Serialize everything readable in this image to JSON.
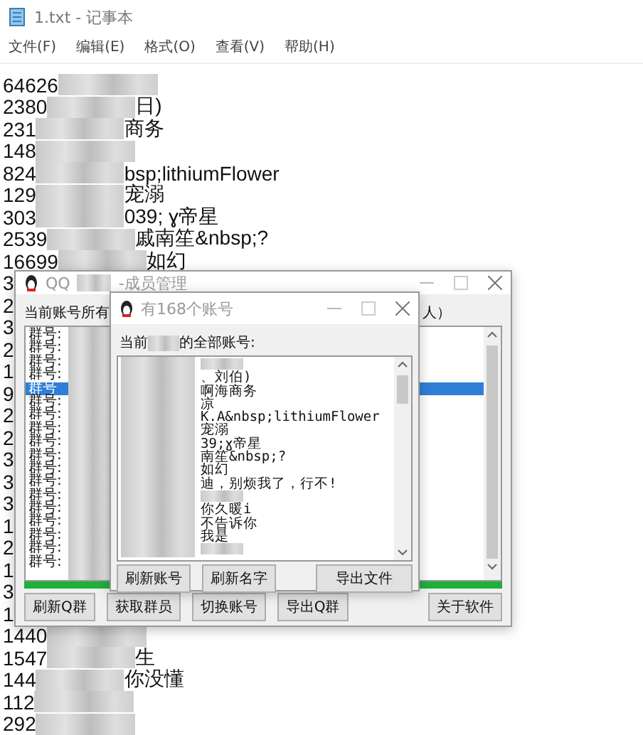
{
  "notepad": {
    "title": "1.txt - 记事本",
    "menu": [
      "文件(F)",
      "编辑(E)",
      "格式(O)",
      "查看(V)",
      "帮助(H)"
    ],
    "lines": [
      {
        "prefix": "64626",
        "redacted": true
      },
      {
        "prefix": "2380",
        "redacted": true,
        "suffix": "日)"
      },
      {
        "prefix": "231",
        "redacted": true,
        "suffix": "商务"
      },
      {
        "prefix": "148",
        "redacted": true
      },
      {
        "prefix": "824",
        "redacted": true,
        "suffix": "bsp;lithiumFlower"
      },
      {
        "prefix": "129",
        "redacted": true,
        "suffix": "宠溺"
      },
      {
        "prefix": "303",
        "redacted": true,
        "suffix": "039; ɣ帝星"
      },
      {
        "prefix": "2539",
        "redacted": true,
        "suffix": "戚南笙&nbsp;?"
      },
      {
        "prefix": "16699",
        "redacted": true,
        "suffix": "如幻"
      },
      {
        "prefix": "3"
      },
      {
        "prefix": "2"
      },
      {
        "prefix": "3"
      },
      {
        "prefix": "2"
      },
      {
        "prefix": "1"
      },
      {
        "prefix": "9"
      },
      {
        "prefix": "2"
      },
      {
        "prefix": "2"
      },
      {
        "prefix": "3"
      },
      {
        "prefix": "3"
      },
      {
        "prefix": "3"
      },
      {
        "prefix": "1"
      },
      {
        "prefix": "2"
      },
      {
        "prefix": "1"
      },
      {
        "prefix": "3"
      },
      {
        "prefix": "1"
      },
      {
        "prefix": "1440",
        "redacted": true
      },
      {
        "prefix": "1547",
        "redacted": true,
        "suffix": "生"
      },
      {
        "prefix": "144",
        "redacted": true,
        "suffix": "你没懂"
      },
      {
        "prefix": "112",
        "redacted": true
      },
      {
        "prefix": "292",
        "redacted": true
      }
    ]
  },
  "qq_window": {
    "title_prefix": "QQ",
    "title_suffix": "-成员管理",
    "header_left": "当前账号所有",
    "header_right": "人）",
    "groups": [
      {
        "label": "群号:",
        "selected": false
      },
      {
        "label": "群号:",
        "selected": false
      },
      {
        "label": "群号:",
        "selected": false
      },
      {
        "label": "群号:",
        "selected": false
      },
      {
        "label": "群号",
        "selected": true
      },
      {
        "label": "群号:",
        "selected": false
      },
      {
        "label": "群号:",
        "selected": false
      },
      {
        "label": "群号:",
        "selected": false
      },
      {
        "label": "群号:",
        "selected": false
      },
      {
        "label": "群号:",
        "selected": false
      },
      {
        "label": "群号:",
        "selected": false
      },
      {
        "label": "群号:",
        "selected": false
      },
      {
        "label": "群号:",
        "selected": false
      },
      {
        "label": "群号:",
        "selected": false
      },
      {
        "label": "群号:",
        "selected": false
      },
      {
        "label": "群号:",
        "selected": false
      },
      {
        "label": "群号:",
        "selected": false
      },
      {
        "label": "群号:",
        "selected": false
      }
    ],
    "progress": {
      "level": 1
    },
    "buttons": [
      "刷新Q群",
      "获取群员",
      "切换账号",
      "导出Q群",
      "关于软件"
    ]
  },
  "accounts_window": {
    "title": "有168个账号",
    "label_prefix": "当前",
    "label_suffix": "的全部账号:",
    "lines": [
      {
        "kind": "blurred"
      },
      {
        "kind": "text",
        "text": "、刘伯)"
      },
      {
        "kind": "text",
        "text": "啊海商务"
      },
      {
        "kind": "text",
        "text": "凉"
      },
      {
        "kind": "text",
        "text": "K.A&nbsp;lithiumFlower"
      },
      {
        "kind": "text",
        "text": "宠溺"
      },
      {
        "kind": "text",
        "text": "39;ɣ帝星"
      },
      {
        "kind": "text",
        "text": "南笙&nbsp;?"
      },
      {
        "kind": "text",
        "text": "如幻"
      },
      {
        "kind": "text",
        "text": "迪，别烦我了，行不!"
      },
      {
        "kind": "blurred"
      },
      {
        "kind": "text",
        "text": "你久暖i"
      },
      {
        "kind": "text",
        "text": "不告诉你"
      },
      {
        "kind": "text",
        "text": "我是"
      },
      {
        "kind": "blurred"
      }
    ],
    "buttons": [
      "刷新账号",
      "刷新名字",
      "导出文件"
    ]
  }
}
